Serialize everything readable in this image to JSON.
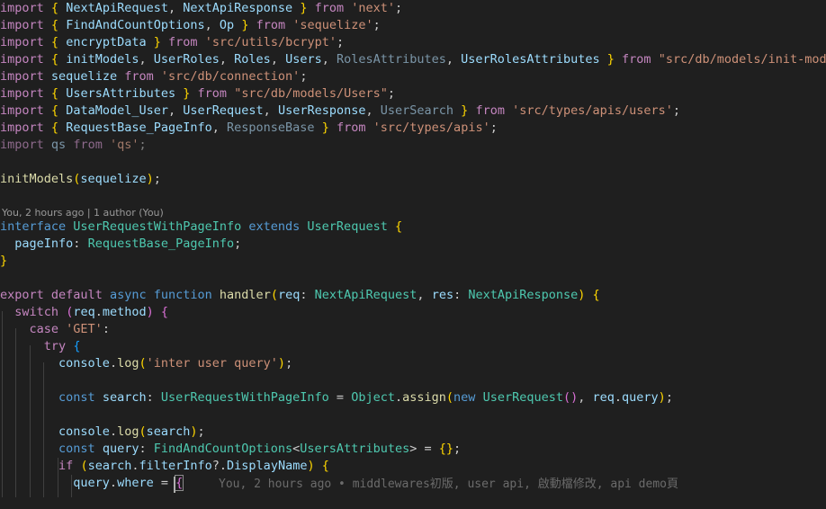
{
  "editor": {
    "theme": {
      "background": "#1f1f1f"
    },
    "codelens": "You, 2 hours ago | 1 author (You)",
    "inline_blame": "You, 2 hours ago • middlewares初版, user api, 啟動檔修改, api demo頁",
    "lines": [
      [
        [
          "import",
          "kw"
        ],
        [
          " ",
          "pu"
        ],
        [
          "{",
          "p1"
        ],
        [
          " ",
          "pu"
        ],
        [
          "NextApiRequest",
          "id"
        ],
        [
          ", ",
          "pu"
        ],
        [
          "NextApiResponse",
          "id"
        ],
        [
          " ",
          "pu"
        ],
        [
          "}",
          "p1"
        ],
        [
          " ",
          "pu"
        ],
        [
          "from",
          "kw"
        ],
        [
          " ",
          "pu"
        ],
        [
          "'next'",
          "st"
        ],
        [
          ";",
          "pu"
        ]
      ],
      [
        [
          "import",
          "kw"
        ],
        [
          " ",
          "pu"
        ],
        [
          "{",
          "p1"
        ],
        [
          " ",
          "pu"
        ],
        [
          "FindAndCountOptions",
          "id"
        ],
        [
          ", ",
          "pu"
        ],
        [
          "Op",
          "id"
        ],
        [
          " ",
          "pu"
        ],
        [
          "}",
          "p1"
        ],
        [
          " ",
          "pu"
        ],
        [
          "from",
          "kw"
        ],
        [
          " ",
          "pu"
        ],
        [
          "'sequelize'",
          "st"
        ],
        [
          ";",
          "pu"
        ]
      ],
      [
        [
          "import",
          "kw"
        ],
        [
          " ",
          "pu"
        ],
        [
          "{",
          "p1"
        ],
        [
          " ",
          "pu"
        ],
        [
          "encryptData",
          "id"
        ],
        [
          " ",
          "pu"
        ],
        [
          "}",
          "p1"
        ],
        [
          " ",
          "pu"
        ],
        [
          "from",
          "kw"
        ],
        [
          " ",
          "pu"
        ],
        [
          "'src/utils/bcrypt'",
          "st"
        ],
        [
          ";",
          "pu"
        ]
      ],
      [
        [
          "import",
          "kw"
        ],
        [
          " ",
          "pu"
        ],
        [
          "{",
          "p1"
        ],
        [
          " ",
          "pu"
        ],
        [
          "initModels",
          "id"
        ],
        [
          ", ",
          "pu"
        ],
        [
          "UserRoles",
          "id"
        ],
        [
          ", ",
          "pu"
        ],
        [
          "Roles",
          "id"
        ],
        [
          ", ",
          "pu"
        ],
        [
          "Users",
          "id"
        ],
        [
          ", ",
          "pu"
        ],
        [
          "RolesAttributes",
          "dimid"
        ],
        [
          ", ",
          "pu"
        ],
        [
          "UserRolesAttributes",
          "id"
        ],
        [
          " ",
          "pu"
        ],
        [
          "}",
          "p1"
        ],
        [
          " ",
          "pu"
        ],
        [
          "from",
          "kw"
        ],
        [
          " ",
          "pu"
        ],
        [
          "\"src/db/models/init-models\"",
          "st"
        ],
        [
          ";",
          "pu"
        ]
      ],
      [
        [
          "import",
          "kw"
        ],
        [
          " ",
          "pu"
        ],
        [
          "sequelize",
          "id"
        ],
        [
          " ",
          "pu"
        ],
        [
          "from",
          "kw"
        ],
        [
          " ",
          "pu"
        ],
        [
          "'src/db/connection'",
          "st"
        ],
        [
          ";",
          "pu"
        ]
      ],
      [
        [
          "import",
          "kw"
        ],
        [
          " ",
          "pu"
        ],
        [
          "{",
          "p1"
        ],
        [
          " ",
          "pu"
        ],
        [
          "UsersAttributes",
          "id"
        ],
        [
          " ",
          "pu"
        ],
        [
          "}",
          "p1"
        ],
        [
          " ",
          "pu"
        ],
        [
          "from",
          "kw"
        ],
        [
          " ",
          "pu"
        ],
        [
          "\"src/db/models/Users\"",
          "st"
        ],
        [
          ";",
          "pu"
        ]
      ],
      [
        [
          "import",
          "kw"
        ],
        [
          " ",
          "pu"
        ],
        [
          "{",
          "p1"
        ],
        [
          " ",
          "pu"
        ],
        [
          "DataModel_User",
          "id"
        ],
        [
          ", ",
          "pu"
        ],
        [
          "UserRequest",
          "id"
        ],
        [
          ", ",
          "pu"
        ],
        [
          "UserResponse",
          "id"
        ],
        [
          ", ",
          "pu"
        ],
        [
          "UserSearch",
          "dimid"
        ],
        [
          " ",
          "pu"
        ],
        [
          "}",
          "p1"
        ],
        [
          " ",
          "pu"
        ],
        [
          "from",
          "kw"
        ],
        [
          " ",
          "pu"
        ],
        [
          "'src/types/apis/users'",
          "st"
        ],
        [
          ";",
          "pu"
        ]
      ],
      [
        [
          "import",
          "kw"
        ],
        [
          " ",
          "pu"
        ],
        [
          "{",
          "p1"
        ],
        [
          " ",
          "pu"
        ],
        [
          "RequestBase_PageInfo",
          "id"
        ],
        [
          ", ",
          "pu"
        ],
        [
          "ResponseBase",
          "dimid"
        ],
        [
          " ",
          "pu"
        ],
        [
          "}",
          "p1"
        ],
        [
          " ",
          "pu"
        ],
        [
          "from",
          "kw"
        ],
        [
          " ",
          "pu"
        ],
        [
          "'src/types/apis'",
          "st"
        ],
        [
          ";",
          "pu"
        ]
      ],
      [
        [
          "import",
          "dimkw"
        ],
        [
          " ",
          "pu"
        ],
        [
          "qs",
          "dimid"
        ],
        [
          " ",
          "pu"
        ],
        [
          "from",
          "dimkw"
        ],
        [
          " ",
          "pu"
        ],
        [
          "'qs'",
          "dimst"
        ],
        [
          ";",
          "dim"
        ]
      ],
      [],
      [
        [
          "initModels",
          "fn"
        ],
        [
          "(",
          "p1"
        ],
        [
          "sequelize",
          "id"
        ],
        [
          ")",
          "p1"
        ],
        [
          ";",
          "pu"
        ]
      ],
      [],
      [
        [
          "interface",
          "sk"
        ],
        [
          " ",
          "pu"
        ],
        [
          "UserRequestWithPageInfo",
          "ty"
        ],
        [
          " ",
          "pu"
        ],
        [
          "extends",
          "sk"
        ],
        [
          " ",
          "pu"
        ],
        [
          "UserRequest",
          "ty"
        ],
        [
          " ",
          "pu"
        ],
        [
          "{",
          "p1"
        ]
      ],
      [
        [
          "  ",
          "pu"
        ],
        [
          "pageInfo",
          "id"
        ],
        [
          ": ",
          "pu"
        ],
        [
          "RequestBase_PageInfo",
          "ty"
        ],
        [
          ";",
          "pu"
        ]
      ],
      [
        [
          "}",
          "p1"
        ]
      ],
      [],
      [
        [
          "export",
          "kw"
        ],
        [
          " ",
          "pu"
        ],
        [
          "default",
          "kw"
        ],
        [
          " ",
          "pu"
        ],
        [
          "async",
          "sk"
        ],
        [
          " ",
          "pu"
        ],
        [
          "function",
          "sk"
        ],
        [
          " ",
          "pu"
        ],
        [
          "handler",
          "fn"
        ],
        [
          "(",
          "p1"
        ],
        [
          "req",
          "id"
        ],
        [
          ": ",
          "pu"
        ],
        [
          "NextApiRequest",
          "ty"
        ],
        [
          ", ",
          "pu"
        ],
        [
          "res",
          "id"
        ],
        [
          ": ",
          "pu"
        ],
        [
          "NextApiResponse",
          "ty"
        ],
        [
          ")",
          "p1"
        ],
        [
          " ",
          "pu"
        ],
        [
          "{",
          "p1"
        ]
      ],
      [
        [
          "  ",
          "pu"
        ],
        [
          "switch",
          "kw"
        ],
        [
          " ",
          "pu"
        ],
        [
          "(",
          "p2"
        ],
        [
          "req",
          "id"
        ],
        [
          ".",
          "pu"
        ],
        [
          "method",
          "id"
        ],
        [
          ")",
          "p2"
        ],
        [
          " ",
          "pu"
        ],
        [
          "{",
          "p2"
        ]
      ],
      [
        [
          "    ",
          "pu"
        ],
        [
          "case",
          "kw"
        ],
        [
          " ",
          "pu"
        ],
        [
          "'GET'",
          "st"
        ],
        [
          ":",
          "pu"
        ]
      ],
      [
        [
          "      ",
          "pu"
        ],
        [
          "try",
          "kw"
        ],
        [
          " ",
          "pu"
        ],
        [
          "{",
          "p3"
        ]
      ],
      [
        [
          "        ",
          "pu"
        ],
        [
          "console",
          "id"
        ],
        [
          ".",
          "pu"
        ],
        [
          "log",
          "fn"
        ],
        [
          "(",
          "p1"
        ],
        [
          "'inter user query'",
          "st"
        ],
        [
          ")",
          "p1"
        ],
        [
          ";",
          "pu"
        ]
      ],
      [],
      [
        [
          "        ",
          "pu"
        ],
        [
          "const",
          "sk"
        ],
        [
          " ",
          "pu"
        ],
        [
          "search",
          "id"
        ],
        [
          ": ",
          "pu"
        ],
        [
          "UserRequestWithPageInfo",
          "ty"
        ],
        [
          " = ",
          "pu"
        ],
        [
          "Object",
          "ty"
        ],
        [
          ".",
          "pu"
        ],
        [
          "assign",
          "fn"
        ],
        [
          "(",
          "p1"
        ],
        [
          "new",
          "sk"
        ],
        [
          " ",
          "pu"
        ],
        [
          "UserRequest",
          "ty"
        ],
        [
          "()",
          "p2"
        ],
        [
          ", ",
          "pu"
        ],
        [
          "req",
          "id"
        ],
        [
          ".",
          "pu"
        ],
        [
          "query",
          "id"
        ],
        [
          ")",
          "p1"
        ],
        [
          ";",
          "pu"
        ]
      ],
      [],
      [
        [
          "        ",
          "pu"
        ],
        [
          "console",
          "id"
        ],
        [
          ".",
          "pu"
        ],
        [
          "log",
          "fn"
        ],
        [
          "(",
          "p1"
        ],
        [
          "search",
          "id"
        ],
        [
          ")",
          "p1"
        ],
        [
          ";",
          "pu"
        ]
      ],
      [
        [
          "        ",
          "pu"
        ],
        [
          "const",
          "sk"
        ],
        [
          " ",
          "pu"
        ],
        [
          "query",
          "id"
        ],
        [
          ": ",
          "pu"
        ],
        [
          "FindAndCountOptions",
          "ty"
        ],
        [
          "<",
          "pu"
        ],
        [
          "UsersAttributes",
          "ty"
        ],
        [
          ">",
          "pu"
        ],
        [
          " = ",
          "pu"
        ],
        [
          "{}",
          "p1"
        ],
        [
          ";",
          "pu"
        ]
      ],
      [
        [
          "        ",
          "pu"
        ],
        [
          "if",
          "kw"
        ],
        [
          " ",
          "pu"
        ],
        [
          "(",
          "p1"
        ],
        [
          "search",
          "id"
        ],
        [
          ".",
          "pu"
        ],
        [
          "filterInfo",
          "id"
        ],
        [
          "?.",
          "pu"
        ],
        [
          "DisplayName",
          "id"
        ],
        [
          ")",
          "p1"
        ],
        [
          " ",
          "pu"
        ],
        [
          "{",
          "p1"
        ]
      ],
      [
        [
          "          ",
          "pu"
        ],
        [
          "query",
          "id"
        ],
        [
          ".",
          "pu"
        ],
        [
          "where",
          "id"
        ],
        [
          " = ",
          "pu"
        ],
        [
          "{",
          "p2"
        ]
      ],
      [
        [
          "            ",
          "pu"
        ],
        [
          "",
          "pu"
        ]
      ]
    ]
  }
}
